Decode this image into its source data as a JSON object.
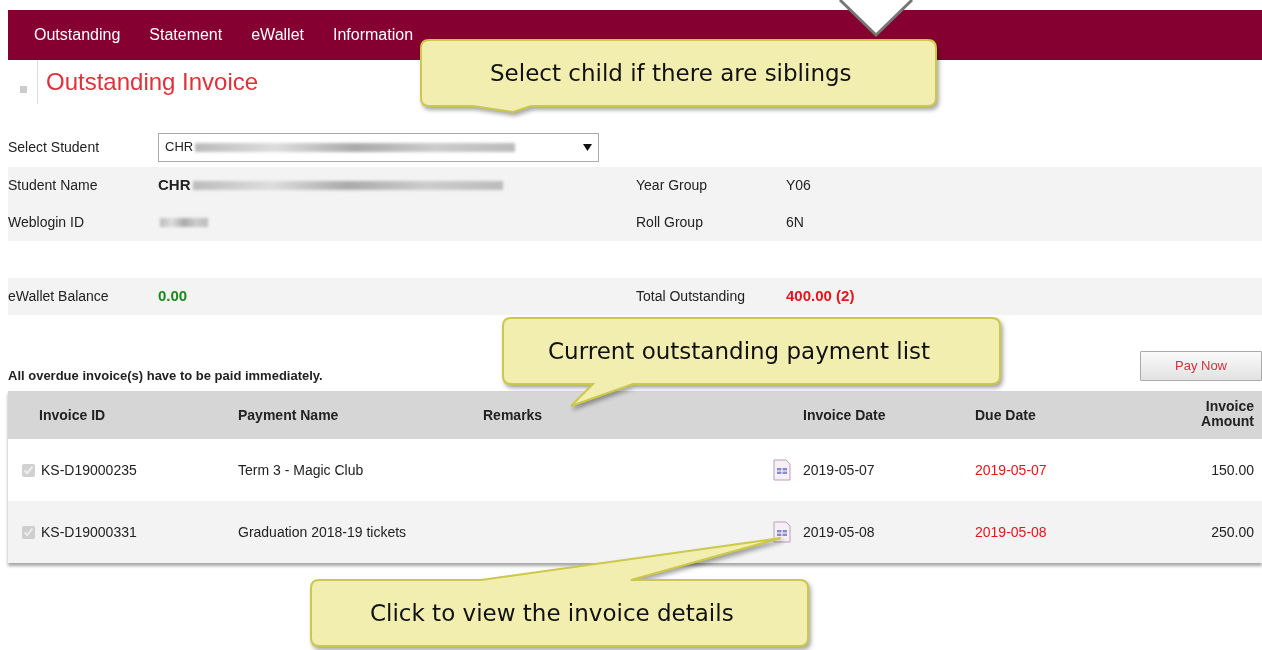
{
  "nav": {
    "items": [
      "Outstanding",
      "Statement",
      "eWallet",
      "Information"
    ]
  },
  "page_title": "Outstanding Invoice",
  "student_select": {
    "label": "Select Student",
    "value": "CHR"
  },
  "info_rows": [
    {
      "label": "Student Name",
      "value": "CHR",
      "redacted": true,
      "label2": "Year Group",
      "value2": "Y06"
    },
    {
      "label": "Weblogin ID",
      "redacted": true,
      "label2": "Roll Group",
      "value2": "6N"
    }
  ],
  "balance_row": {
    "label": "eWallet Balance",
    "value": "0.00",
    "label2": "Total Outstanding",
    "value2": "400.00 (2)"
  },
  "notice": "All overdue invoice(s) have to be paid immediately.",
  "pay_button": "Pay Now",
  "table": {
    "columns": [
      "Invoice ID",
      "Payment Name",
      "Remarks",
      "Invoice Date",
      "Due Date",
      "Invoice Amount"
    ],
    "rows": [
      {
        "checked": true,
        "invoice_id": "KS-D19000235",
        "payment_name": "Term 3 - Magic Club",
        "invoice_date": "2019-05-07",
        "due_date": "2019-05-07",
        "amount": "150.00",
        "overdue": true
      },
      {
        "checked": true,
        "invoice_id": "KS-D19000331",
        "payment_name": "Graduation 2018-19 tickets",
        "invoice_date": "2019-05-08",
        "due_date": "2019-05-08",
        "amount": "250.00",
        "overdue": true
      }
    ]
  },
  "callouts": [
    {
      "text": "Select child if there are siblings"
    },
    {
      "text": "Current outstanding payment list"
    },
    {
      "text": "Click to view the invoice details"
    }
  ]
}
